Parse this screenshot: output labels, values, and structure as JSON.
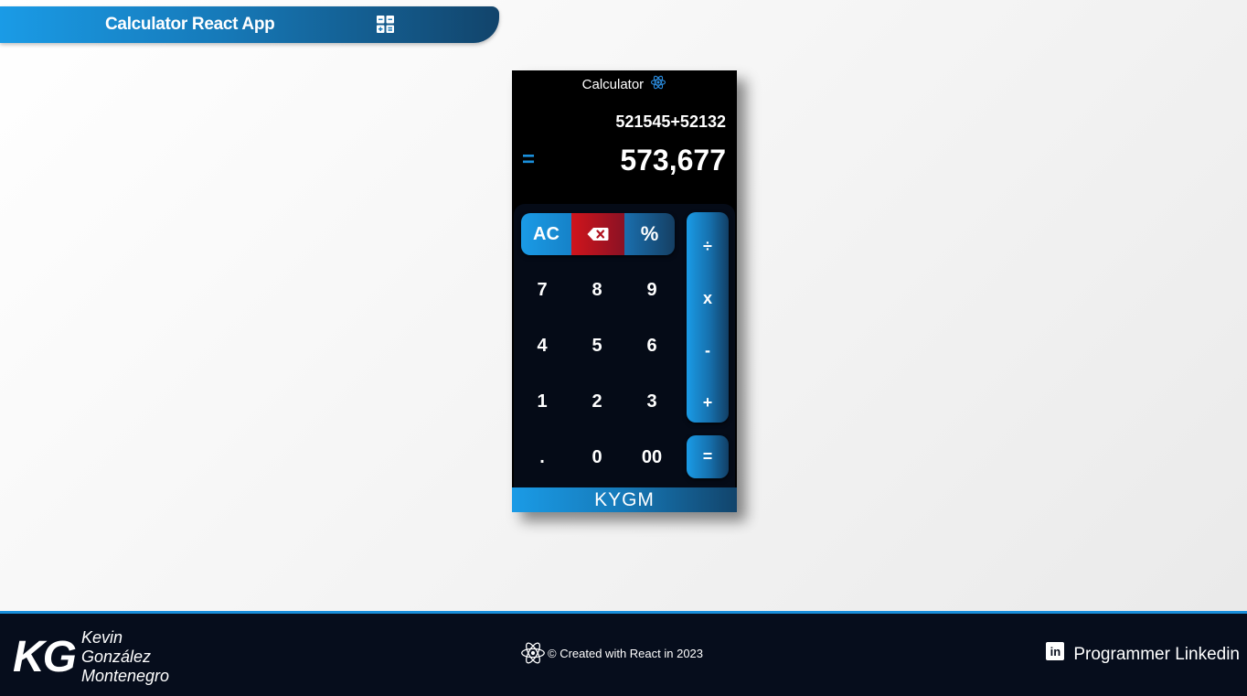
{
  "header": {
    "title": "Calculator React App",
    "icon": "calculator-icon"
  },
  "calculator": {
    "title": "Calculator",
    "title_icon": "react-atom-icon",
    "expression": "521545+52132",
    "equals_sign": "=",
    "result": "573,677",
    "keys": {
      "ac": "AC",
      "delete_icon": "backspace-icon",
      "percent": "%",
      "digits": [
        "7",
        "8",
        "9",
        "4",
        "5",
        "6",
        "1",
        "2",
        "3",
        ".",
        "0",
        "00"
      ],
      "divide": "÷",
      "multiply": "x",
      "subtract": "-",
      "add": "+",
      "equals": "="
    },
    "brand": "KYGM"
  },
  "footer": {
    "logo": "KG",
    "name_line1": "Kevin",
    "name_line2": "González",
    "name_line3": "Montenegro",
    "credit": "© Created with React in 2023",
    "credit_icon": "react-atom-icon",
    "linkedin_label": "Programmer Linkedin",
    "linkedin_icon": "linkedin-icon"
  },
  "colors": {
    "accent": "#1a9be6",
    "accent_dark": "#12446b",
    "delete": "#d0141c",
    "footer_bg": "#060d1c"
  }
}
